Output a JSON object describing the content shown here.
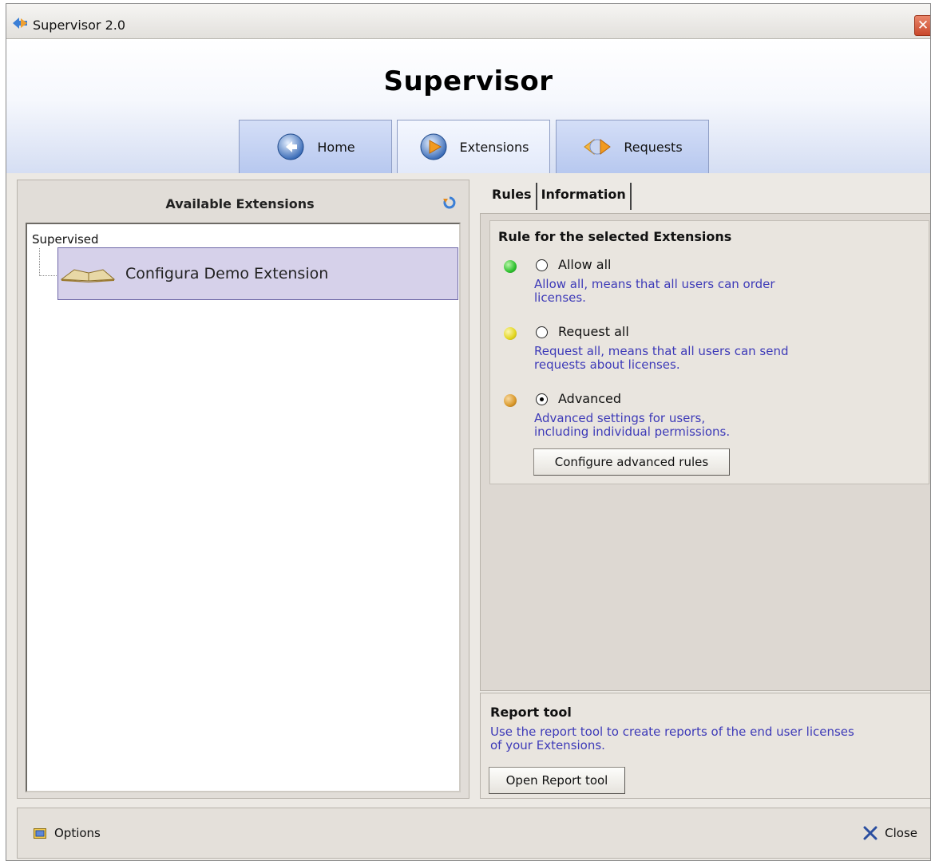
{
  "window": {
    "title": "Supervisor 2.0",
    "icon": "supervisor-logo-icon",
    "close_glyph": "✕"
  },
  "header": {
    "heading": "Supervisor",
    "nav": [
      {
        "label": "Home",
        "icon": "home-icon",
        "active": false
      },
      {
        "label": "Extensions",
        "icon": "extensions-icon",
        "active": true
      },
      {
        "label": "Requests",
        "icon": "requests-icon",
        "active": false
      }
    ]
  },
  "extensions_panel": {
    "title": "Available Extensions",
    "refresh_icon": "refresh-icon",
    "tree": {
      "root": "Supervised",
      "items": [
        {
          "label": "Configura Demo Extension",
          "icon": "book-icon",
          "selected": true
        }
      ]
    }
  },
  "tabs": [
    {
      "label": "Rules",
      "active": true
    },
    {
      "label": "Information",
      "active": false
    }
  ],
  "rules": {
    "title": "Rule for the selected Extensions",
    "options": [
      {
        "label": "Allow all",
        "dot_color": "#2fc12f",
        "checked": false,
        "desc_line1": "Allow all, means that all users can order",
        "desc_line2": "licenses."
      },
      {
        "label": "Request all",
        "dot_color": "#e3d61f",
        "checked": false,
        "desc_line1": "Request all, means that all users can send",
        "desc_line2": "requests about licenses."
      },
      {
        "label": "Advanced",
        "dot_color": "#d9982a",
        "checked": true,
        "desc_line1": "Advanced settings for users,",
        "desc_line2": "including individual permissions."
      }
    ],
    "configure_button": "Configure advanced rules"
  },
  "report_tool": {
    "title": "Report tool",
    "desc_line1": "Use the report tool to create reports of the end user licenses",
    "desc_line2": "of your Extensions.",
    "button": "Open Report tool"
  },
  "footer": {
    "options_label": "Options",
    "options_icon": "options-icon",
    "close_label": "Close",
    "close_icon": "close-icon"
  },
  "colors": {
    "link_text": "#3d3ab8",
    "selection_fill": "#d6d1ea",
    "nav_blue": "#b7c8ef"
  }
}
